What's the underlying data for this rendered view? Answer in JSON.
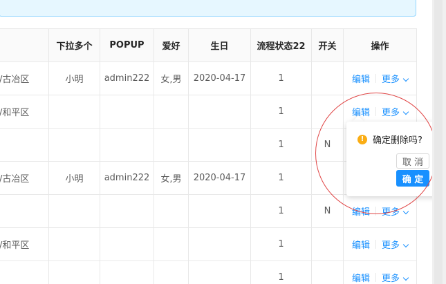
{
  "table": {
    "headers": [
      "",
      "下拉多个",
      "POPUP",
      "爱好",
      "生日",
      "流程状态22",
      "开关",
      "操作"
    ],
    "rows": [
      {
        "addr": "/古冶区",
        "dropdown": "小明",
        "popup": "admin222",
        "hobby": "女,男",
        "birthday": "2020-04-17",
        "status": "1",
        "switch": "",
        "edit": "编辑",
        "more": "更多"
      },
      {
        "addr": "/和平区",
        "dropdown": "",
        "popup": "",
        "hobby": "",
        "birthday": "",
        "status": "1",
        "switch": "",
        "edit": "编辑",
        "more": "更多"
      },
      {
        "addr": "",
        "dropdown": "",
        "popup": "",
        "hobby": "",
        "birthday": "",
        "status": "1",
        "switch": "N",
        "edit": "",
        "more": ""
      },
      {
        "addr": "/古冶区",
        "dropdown": "小明",
        "popup": "admin222",
        "hobby": "女,男",
        "birthday": "2020-04-17",
        "status": "1",
        "switch": "",
        "edit": "",
        "more": ""
      },
      {
        "addr": "",
        "dropdown": "",
        "popup": "",
        "hobby": "",
        "birthday": "",
        "status": "1",
        "switch": "N",
        "edit": "编辑",
        "more": "更多"
      },
      {
        "addr": "/和平区",
        "dropdown": "",
        "popup": "",
        "hobby": "",
        "birthday": "",
        "status": "1",
        "switch": "",
        "edit": "编辑",
        "more": "更多"
      },
      {
        "addr": "",
        "dropdown": "",
        "popup": "",
        "hobby": "",
        "birthday": "",
        "status": "1",
        "switch": "",
        "edit": "编辑",
        "more": "更多"
      }
    ]
  },
  "popconfirm": {
    "message": "确定删除吗?",
    "cancel_label": "取 消",
    "ok_label": "确 定"
  },
  "colors": {
    "primary": "#1890ff",
    "warning": "#faad14",
    "annotation": "#e04545"
  }
}
